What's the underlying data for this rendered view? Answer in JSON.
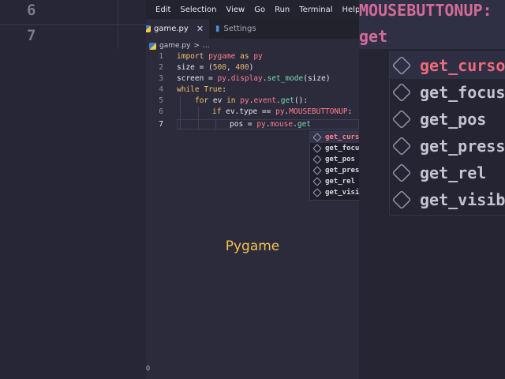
{
  "menu": [
    "Edit",
    "Selection",
    "View",
    "Go",
    "Run",
    "Terminal",
    "Help"
  ],
  "tabs": [
    {
      "label": "game.py",
      "close": "✕"
    },
    {
      "label": "Settings"
    }
  ],
  "breadcrumb": {
    "file": "game.py",
    "sep": ">",
    "rest": "..."
  },
  "lines": [
    {
      "num": "1"
    },
    {
      "num": "2"
    },
    {
      "num": "3"
    },
    {
      "num": "4"
    },
    {
      "num": "5"
    },
    {
      "num": "6"
    },
    {
      "num": "7"
    }
  ],
  "tokens": {
    "l1": {
      "import": "import",
      "mod": "pygame",
      "as": "as",
      "alias": "py"
    },
    "l2": {
      "name": "size",
      "op": " = (",
      "n1": "500",
      "sep": ", ",
      "n2": "400",
      "end": ")"
    },
    "l3": {
      "name": "screen",
      "op": " = ",
      "obj": "py",
      "dot1": ".",
      "attr1": "display",
      "dot2": ".",
      "fn": "set_mode",
      "args": "(size)"
    },
    "l4": {
      "kw": "while",
      "val": "True",
      "end": ":"
    },
    "l5": {
      "kw": "for",
      "var": " ev ",
      "in": "in",
      "obj": "py",
      "dot1": ".",
      "attr1": "event",
      "dot2": ".",
      "fn": "get",
      "end": "():"
    },
    "l6": {
      "kw": "if",
      "lhs": " ev.type == ",
      "obj": "py",
      "dot": ".",
      "const": "MOUSEBUTTONUP",
      "end": ":"
    },
    "l7": {
      "lhs": "pos = ",
      "obj": "py",
      "dot1": ".",
      "attr1": "mouse",
      "dot2": ".",
      "fn": "get"
    }
  },
  "autocomplete": [
    "get_cursor",
    "get_focused",
    "get_pos",
    "get_pressed",
    "get_rel",
    "get_visible"
  ],
  "background": {
    "line_nums": [
      "6",
      "7"
    ],
    "code_top": "MOUSEBUTTONUP:",
    "code_bottom": "get",
    "items": [
      "get_cursor",
      "get_focused",
      "get_pos",
      "get_pressed",
      "get_rel",
      "get_visible"
    ]
  },
  "caption": "Pygame",
  "status": "0",
  "colors": {
    "accent": "#f4c44e",
    "keyword": "#f3c26a",
    "module": "#ff7d8e",
    "function": "#78d9b0"
  }
}
